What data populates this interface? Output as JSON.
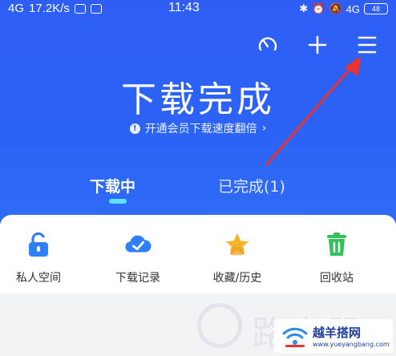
{
  "status_bar": {
    "signal": "4G",
    "speed": "17.2K/s",
    "time": "11:43",
    "network": "4G",
    "battery": "48"
  },
  "header": {
    "title": "下载完成",
    "vip_text": "开通会员下载速度翻倍",
    "actions": [
      {
        "icon": "speedometer-icon"
      },
      {
        "icon": "plus-icon"
      },
      {
        "icon": "menu-icon"
      }
    ]
  },
  "tabs": [
    {
      "label": "下载中",
      "active": true
    },
    {
      "label": "已完成(1)",
      "active": false
    }
  ],
  "shortcuts": [
    {
      "label": "私人空间",
      "icon": "lock-icon",
      "color": "#2f80f7"
    },
    {
      "label": "下载记录",
      "icon": "cloud-check-icon",
      "color": "#2f80f7"
    },
    {
      "label": "收藏/历史",
      "icon": "star-icon",
      "color": "#f5b52b"
    },
    {
      "label": "回收站",
      "icon": "trash-icon",
      "color": "#35c25a"
    }
  ],
  "watermark": {
    "text": "路由器",
    "badge_text": "越羊搭网",
    "badge_url": "www.yueyangbang.com"
  },
  "colors": {
    "header_bg": "#2f62f5",
    "tab_indicator": "#5fe0ff",
    "annotation_arrow": "#e8332e"
  }
}
